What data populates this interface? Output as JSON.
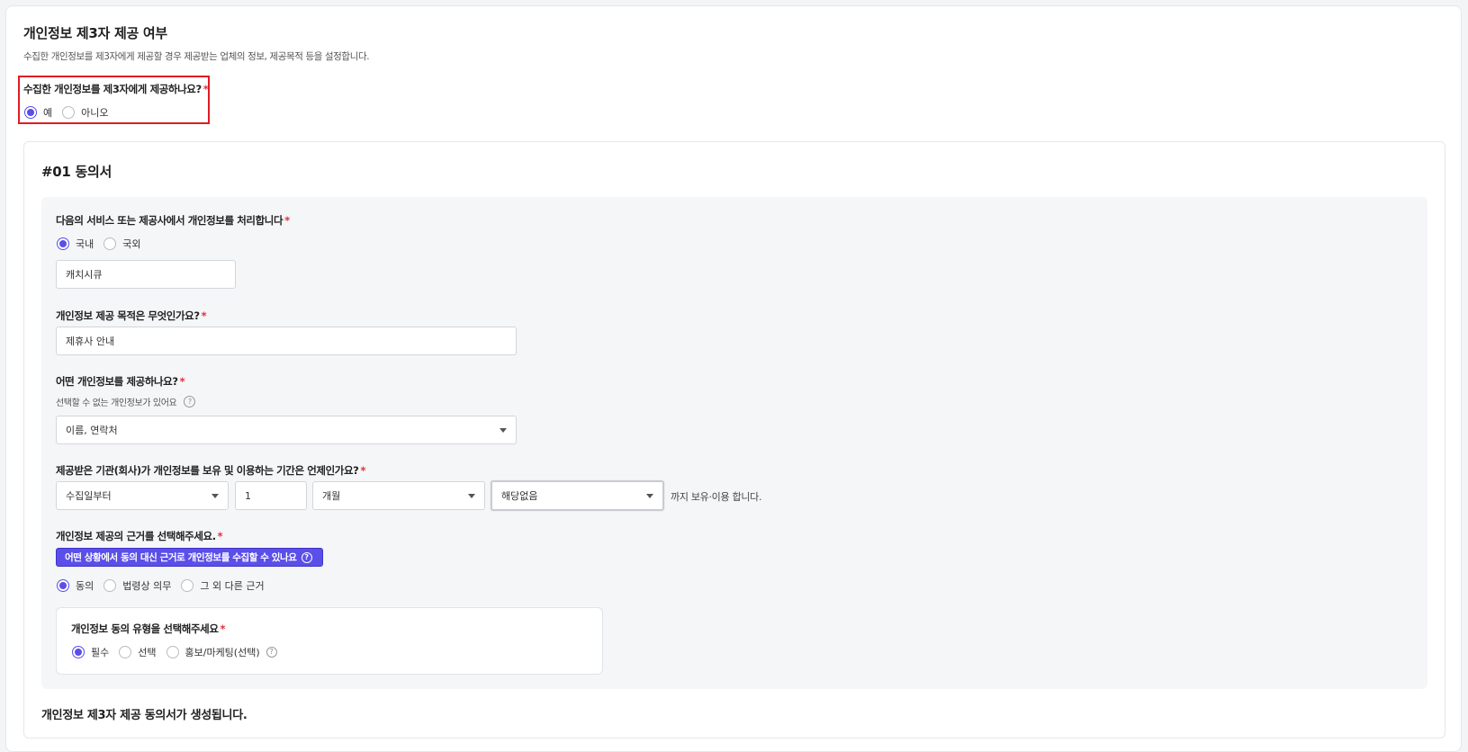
{
  "section": {
    "title": "개인정보 제3자 제공 여부",
    "description": "수집한 개인정보를 제3자에게 제공할 경우 제공받는 업체의 정보, 제공목적 등을 설정합니다."
  },
  "provide_question": {
    "label": "수집한 개인정보를 제3자에게 제공하나요?",
    "required_mark": "*",
    "options": [
      "예",
      "아니오"
    ],
    "selected": "예"
  },
  "consent": {
    "title": "#01 동의서",
    "service": {
      "label": "다음의 서비스 또는 제공사에서 개인정보를 처리합니다",
      "required_mark": "*",
      "options": [
        "국내",
        "국외"
      ],
      "selected": "국내",
      "provider_value": "캐치시큐"
    },
    "purpose": {
      "label": "개인정보 제공 목적은 무엇인가요?",
      "required_mark": "*",
      "value": "제휴사 안내"
    },
    "items": {
      "label": "어떤 개인정보를 제공하나요?",
      "required_mark": "*",
      "hint": "선택할 수 없는 개인정보가 있어요",
      "help_icon": "?",
      "value": "이름, 연락처"
    },
    "retention": {
      "label": "제공받은 기관(회사)가 개인정보를 보유 및 이용하는 기간은 언제인가요?",
      "required_mark": "*",
      "start_value": "수집일부터",
      "amount_value": "1",
      "unit_value": "개월",
      "exception_value": "해당없음",
      "suffix": "까지 보유·이용 합니다."
    },
    "basis": {
      "label": "개인정보 제공의 근거를 선택해주세요.",
      "required_mark": "*",
      "info_button": "어떤 상황에서 동의 대신 근거로 개인정보를 수집할 수 있나요",
      "help_icon": "?",
      "options": [
        "동의",
        "법령상 의무",
        "그 외 다른 근거"
      ],
      "selected": "동의"
    },
    "consent_type": {
      "label": "개인정보 동의 유형을 선택해주세요",
      "required_mark": "*",
      "options": [
        "필수",
        "선택",
        "홍보/마케팅(선택)"
      ],
      "selected": "필수",
      "help_icon": "?"
    },
    "footer_note": "개인정보 제3자 제공 동의서가 생성됩니다."
  },
  "colors": {
    "accent": "#5b4fe9",
    "required": "#e0313b",
    "highlight_border": "#e01b24",
    "panel_bg": "#f5f6f8"
  }
}
